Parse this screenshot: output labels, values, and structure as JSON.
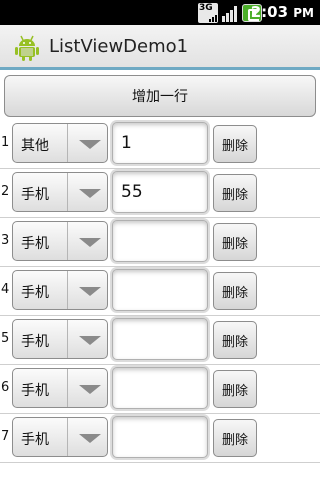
{
  "status_bar": {
    "network_label": "3G",
    "time": "2:03",
    "time_suffix": "PM"
  },
  "app": {
    "title": "ListViewDemo1"
  },
  "add_button_label": "增加一行",
  "delete_label": "删除",
  "rows": [
    {
      "index": "1",
      "spinner_value": "其他",
      "text_value": "1"
    },
    {
      "index": "2",
      "spinner_value": "手机",
      "text_value": "55"
    },
    {
      "index": "3",
      "spinner_value": "手机",
      "text_value": ""
    },
    {
      "index": "4",
      "spinner_value": "手机",
      "text_value": ""
    },
    {
      "index": "5",
      "spinner_value": "手机",
      "text_value": ""
    },
    {
      "index": "6",
      "spinner_value": "手机",
      "text_value": ""
    },
    {
      "index": "7",
      "spinner_value": "手机",
      "text_value": ""
    }
  ],
  "colors": {
    "title_underline": "#6ea9c3",
    "battery": "#4caf2a",
    "android_green": "#97c024"
  },
  "icons": {
    "app": "android-robot-icon",
    "network": "3g-signal-icon",
    "signal": "signal-strength-icon",
    "battery": "battery-charging-icon",
    "spinner": "dropdown-arrow-icon"
  }
}
